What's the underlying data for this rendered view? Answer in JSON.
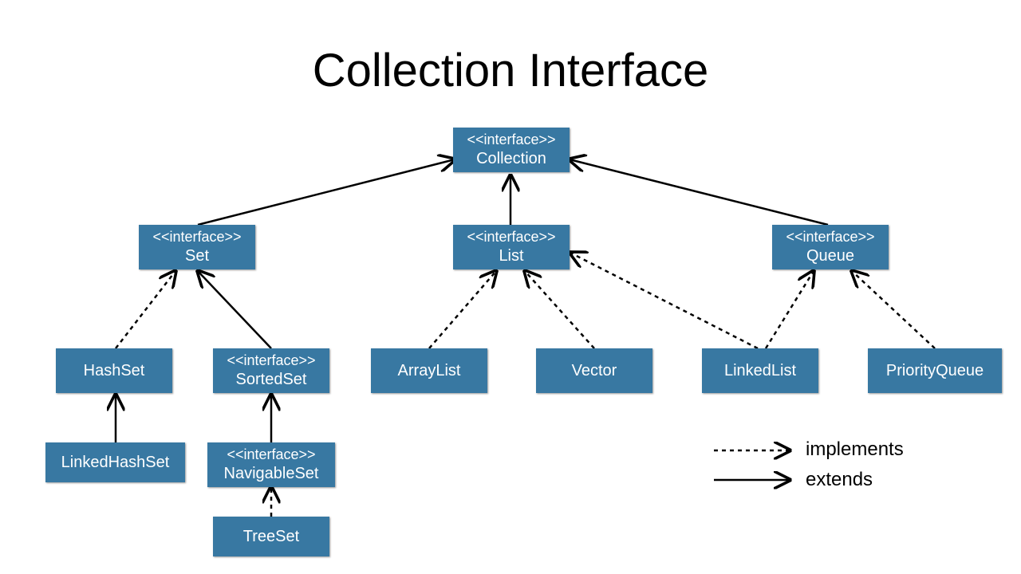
{
  "title": "Collection Interface",
  "stereotype": "<<interface>>",
  "nodes": {
    "collection": "Collection",
    "set": "Set",
    "list": "List",
    "queue": "Queue",
    "hashset": "HashSet",
    "sortedset": "SortedSet",
    "arraylist": "ArrayList",
    "vector": "Vector",
    "linkedlist": "LinkedList",
    "priorityqueue": "PriorityQueue",
    "linkedhashset": "LinkedHashSet",
    "navigableset": "NavigableSet",
    "treeset": "TreeSet"
  },
  "legend": {
    "implements": "implements",
    "extends": "extends"
  },
  "colors": {
    "box": "#3878a2",
    "line": "#000000"
  }
}
